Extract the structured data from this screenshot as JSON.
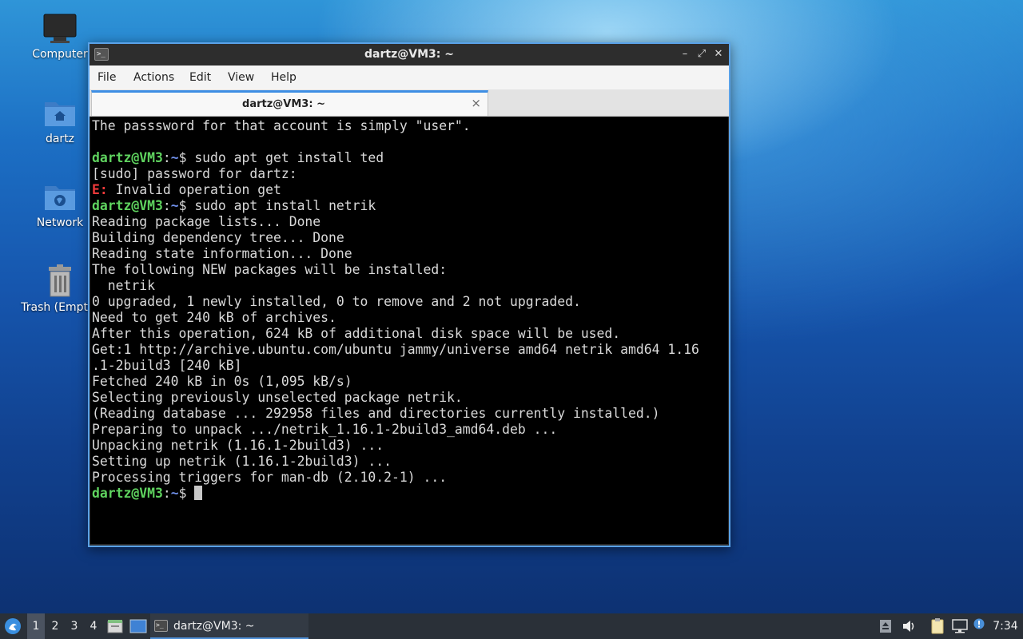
{
  "desktop": {
    "icons": [
      {
        "label": "Computer"
      },
      {
        "label": "dartz"
      },
      {
        "label": "Network"
      },
      {
        "label": "Trash (Empty)"
      }
    ]
  },
  "window": {
    "title": "dartz@VM3: ~",
    "menu": [
      "File",
      "Actions",
      "Edit",
      "View",
      "Help"
    ],
    "tab": {
      "title": "dartz@VM3: ~",
      "close": "×"
    }
  },
  "terminal": {
    "prompt_user": "dartz@VM3",
    "prompt_path": "~",
    "prompt_sep": ":",
    "prompt_end": "$ ",
    "lines": [
      "The passsword for that account is simply \"user\".",
      "",
      {
        "cmd": "sudo apt get install ted"
      },
      "[sudo] password for dartz:",
      {
        "err": "E:",
        "text": " Invalid operation get"
      },
      {
        "cmd": "sudo apt install netrik"
      },
      "Reading package lists... Done",
      "Building dependency tree... Done",
      "Reading state information... Done",
      "The following NEW packages will be installed:",
      "  netrik",
      "0 upgraded, 1 newly installed, 0 to remove and 2 not upgraded.",
      "Need to get 240 kB of archives.",
      "After this operation, 624 kB of additional disk space will be used.",
      "Get:1 http://archive.ubuntu.com/ubuntu jammy/universe amd64 netrik amd64 1.16",
      ".1-2build3 [240 kB]",
      "Fetched 240 kB in 0s (1,095 kB/s)",
      "Selecting previously unselected package netrik.",
      "(Reading database ... 292958 files and directories currently installed.)",
      "Preparing to unpack .../netrik_1.16.1-2build3_amd64.deb ...",
      "Unpacking netrik (1.16.1-2build3) ...",
      "Setting up netrik (1.16.1-2build3) ...",
      "Processing triggers for man-db (2.10.2-1) ...",
      {
        "cmd": "",
        "cursor": true
      }
    ]
  },
  "taskbar": {
    "workspaces": [
      "1",
      "2",
      "3",
      "4"
    ],
    "active_workspace": "1",
    "task_title": "dartz@VM3: ~",
    "clock": "7:34"
  }
}
